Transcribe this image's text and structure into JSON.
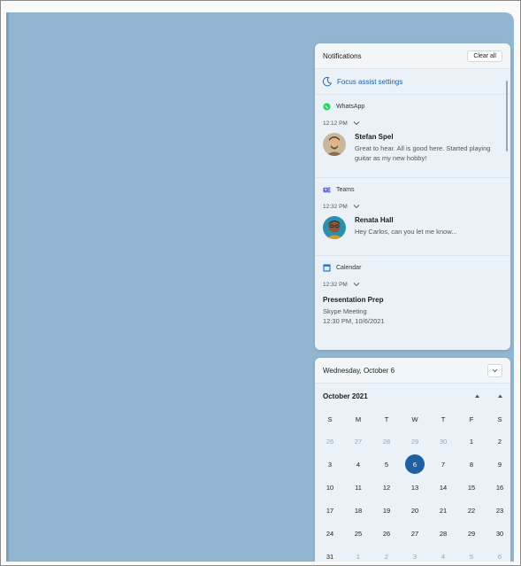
{
  "notifications": {
    "title": "Notifications",
    "clear_all": "Clear all",
    "focus_assist": "Focus assist settings",
    "groups": [
      {
        "app": "WhatsApp",
        "icon": "whatsapp-icon",
        "time": "12:12 PM",
        "sender": "Stefan Spel",
        "message": "Great to hear. All is good here. Started playing guitar as my new hobby!"
      },
      {
        "app": "Teams",
        "icon": "teams-icon",
        "time": "12:32 PM",
        "sender": "Renata Hall",
        "message": "Hey Carlos, can you let me know..."
      },
      {
        "app": "Calendar",
        "icon": "calendar-icon",
        "time": "12:32 PM",
        "event_title": "Presentation Prep",
        "event_location": "Skype Meeting",
        "event_time": "12:30 PM, 10/6/2021"
      }
    ]
  },
  "calendar": {
    "selected_date": "Wednesday, October 6",
    "month": "October 2021",
    "weekdays": [
      "S",
      "M",
      "T",
      "W",
      "T",
      "F",
      "S"
    ],
    "days": [
      "26",
      "27",
      "28",
      "29",
      "30",
      "1",
      "2",
      "3",
      "4",
      "5",
      "6",
      "7",
      "8",
      "9",
      "10",
      "11",
      "12",
      "13",
      "14",
      "15",
      "16",
      "17",
      "18",
      "19",
      "20",
      "21",
      "22",
      "23",
      "24",
      "25",
      "26",
      "27",
      "28",
      "29",
      "30",
      "31",
      "1",
      "2",
      "3",
      "4",
      "5",
      "6"
    ],
    "today_index": 10
  },
  "colors": {
    "desktop": "#92b6cf",
    "accent": "#1f5ea0",
    "whatsapp": "#25d366",
    "teams": "#5b5fc7",
    "calendar": "#1a73c8"
  }
}
